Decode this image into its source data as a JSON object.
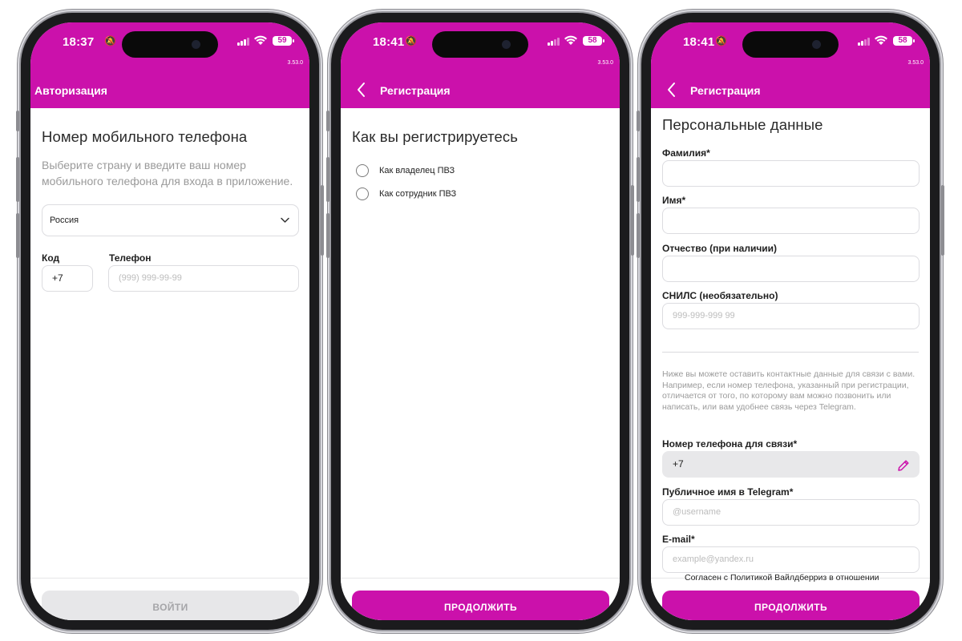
{
  "colors": {
    "brand": "#cb11ab",
    "disabled_bg": "#e7e7e9",
    "disabled_text": "#a5a5a8"
  },
  "screen1": {
    "status": {
      "time": "18:37",
      "battery": "59",
      "version": "3.53.0"
    },
    "header_title": "Авторизация",
    "heading": "Номер мобильного телефона",
    "hint": "Выберите страну и введите ваш номер мобильного телефона для входа в приложение.",
    "country_value": "Россия",
    "code_label": "Код",
    "code_value": "+7",
    "phone_label": "Телефон",
    "phone_placeholder": "(999) 999-99-99",
    "submit_label": "ВОЙТИ"
  },
  "screen2": {
    "status": {
      "time": "18:41",
      "battery": "58",
      "version": "3.53.0"
    },
    "header_title": "Регистрация",
    "heading": "Как вы регистрируетесь",
    "options": [
      "Как владелец ПВЗ",
      "Как сотрудник ПВЗ"
    ],
    "submit_label": "ПРОДОЛЖИТЬ"
  },
  "screen3": {
    "status": {
      "time": "18:41",
      "battery": "58",
      "version": "3.53.0"
    },
    "header_title": "Регистрация",
    "heading": "Персональные данные",
    "last_name_label": "Фамилия*",
    "first_name_label": "Имя*",
    "patronymic_label": "Отчество (при наличии)",
    "snils_label": "СНИЛС (необязательно)",
    "snils_placeholder": "999-999-999 99",
    "contact_note": "Ниже вы можете оставить контактные данные для связи с вами. Например, если номер телефона, указанный при регистрации, отличается от того, по которому вам можно позвонить или написать, или вам удобнее связь через Telegram.",
    "contact_phone_label": "Номер телефона для связи*",
    "contact_phone_value": "+7",
    "telegram_label": "Публичное имя в Telegram*",
    "telegram_placeholder": "@username",
    "email_label": "E-mail*",
    "email_placeholder": "example@yandex.ru",
    "consent_text": "Согласен с Политикой Вайлдберриз в отношении",
    "submit_label": "ПРОДОЛЖИТЬ"
  }
}
